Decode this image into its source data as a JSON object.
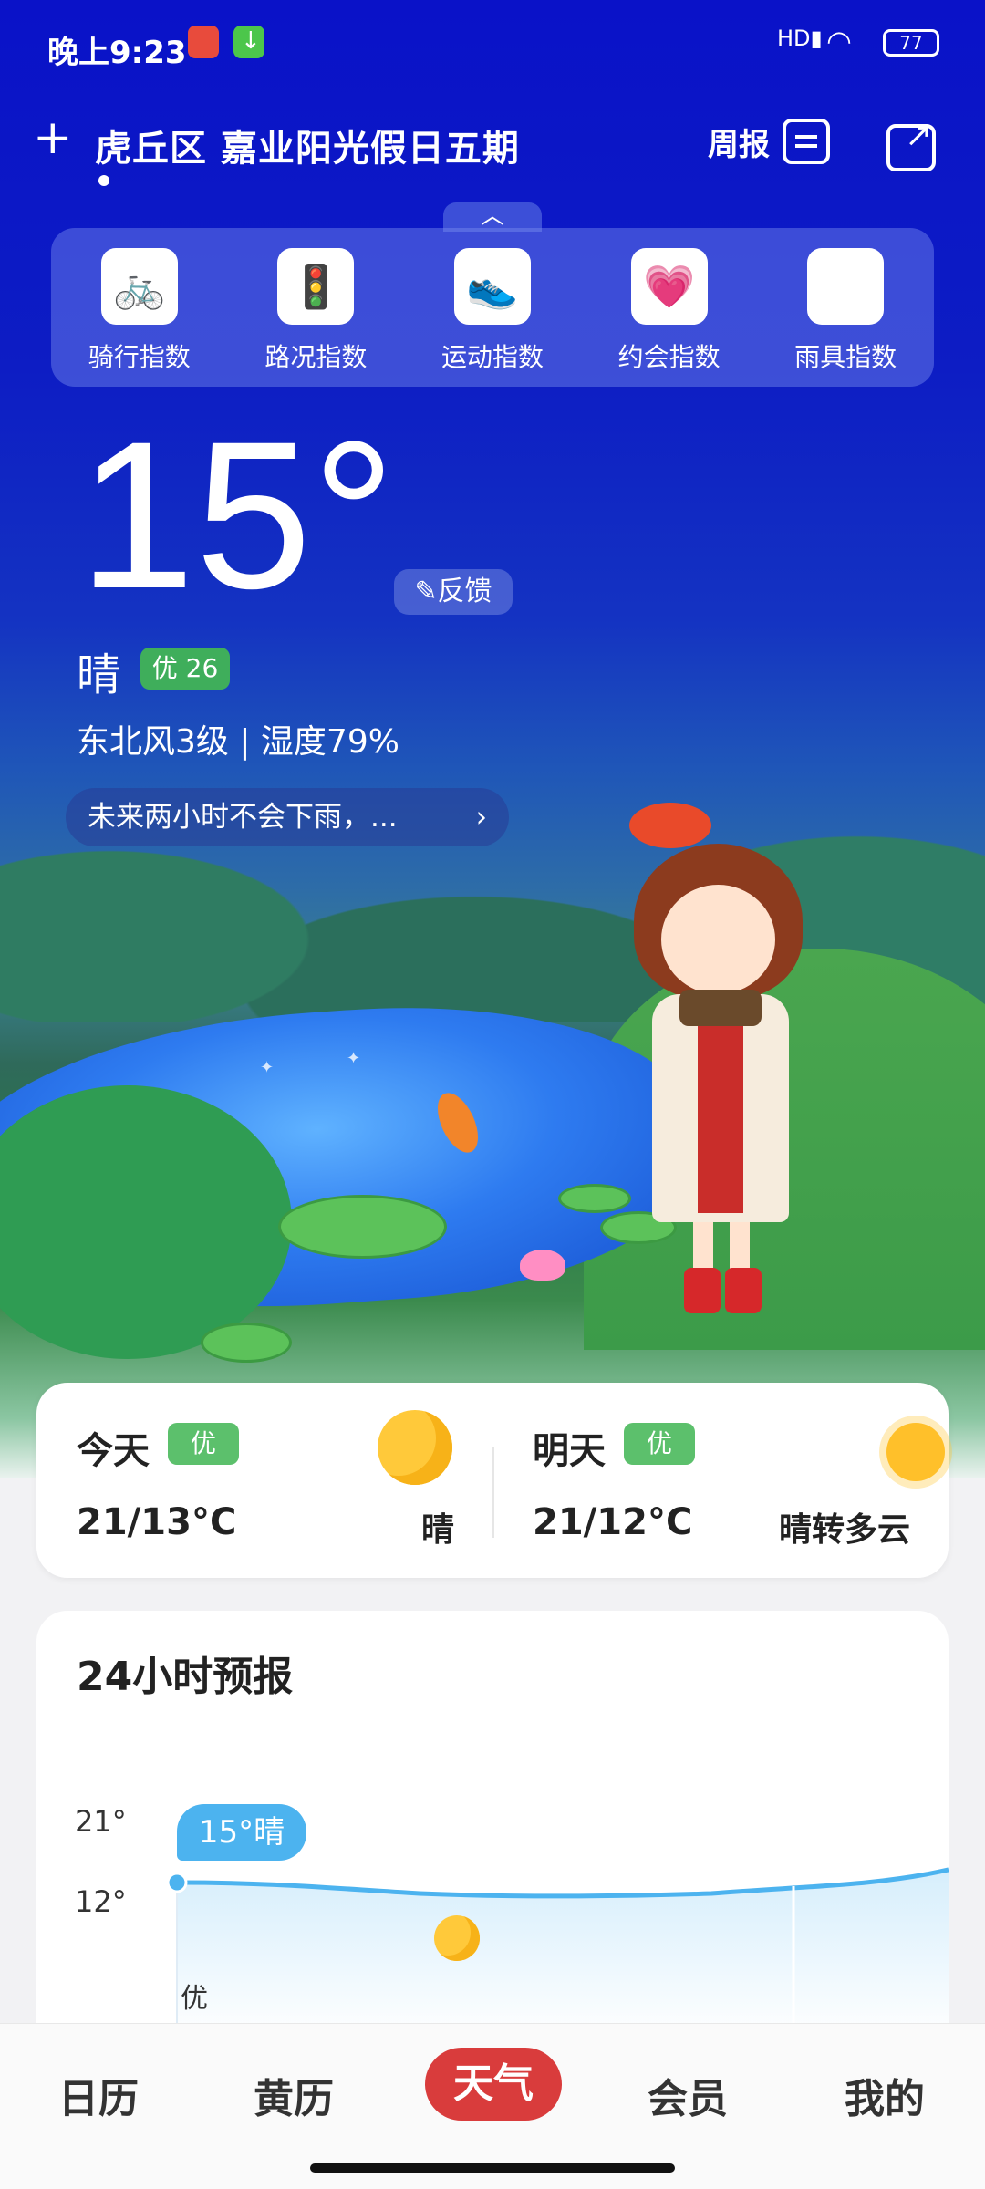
{
  "status_bar": {
    "time": "晚上9:23",
    "signal": "HD",
    "battery": "77"
  },
  "header": {
    "location": "虎丘区  嘉业阳光假日五期",
    "weekly_label": "周报"
  },
  "indices": [
    {
      "label": "骑行指数",
      "icon": "bicycle-icon",
      "glyph": "🚲"
    },
    {
      "label": "路况指数",
      "icon": "traffic-light-icon",
      "glyph": "🚦"
    },
    {
      "label": "运动指数",
      "icon": "sneaker-icon",
      "glyph": "👟"
    },
    {
      "label": "约会指数",
      "icon": "heart-icon",
      "glyph": "💗"
    },
    {
      "label": "雨具指数",
      "icon": "umbrella-icon",
      "glyph": "☂"
    }
  ],
  "current": {
    "temperature": "15°",
    "feedback_label": "✎反馈",
    "condition": "晴",
    "aqi_badge": "优 26",
    "wind_humidity": "东北风3级 | 湿度79%",
    "rain_banner": "未来两小时不会下雨，...",
    "chevron": "›"
  },
  "days": {
    "today": {
      "name": "今天",
      "aqi": "优",
      "temp": "21/13°C",
      "desc": "晴",
      "icon": "moon-icon"
    },
    "tomorrow": {
      "name": "明天",
      "aqi": "优",
      "temp": "21/12°C",
      "desc": "晴转多云",
      "icon": "sun-icon"
    }
  },
  "forecast": {
    "title": "24小时预报",
    "y_top": "21°",
    "y_bottom": "12°",
    "tooltip": "15°晴",
    "aqi": "优"
  },
  "nav": [
    "日历",
    "黄历",
    "天气",
    "会员",
    "我的"
  ],
  "colors": {
    "hero_top": "#0a12c8",
    "accent_red": "#d93c3c",
    "aqi_green": "#5cc06c",
    "chart_line": "#4cb3ef"
  }
}
